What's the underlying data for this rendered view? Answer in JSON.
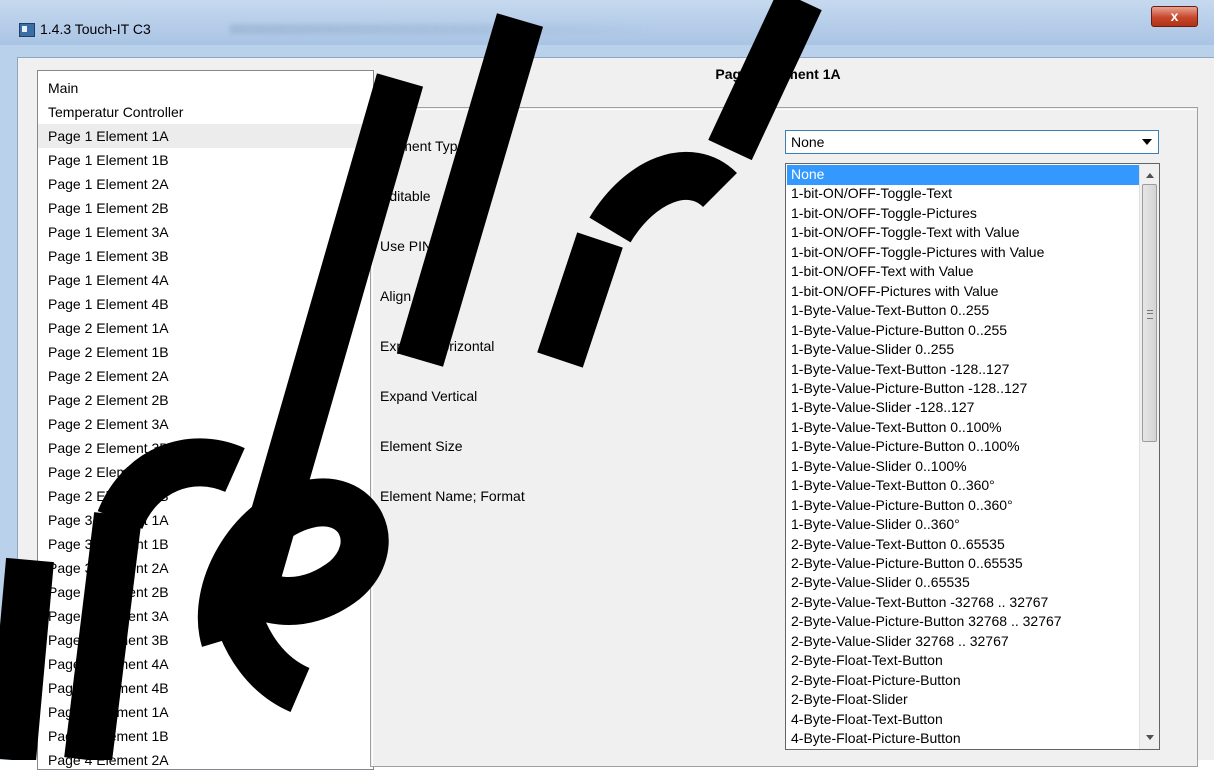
{
  "window": {
    "title": "1.4.3 Touch-IT C3",
    "close_label": "x"
  },
  "tree": {
    "items": [
      "Main",
      "Temperatur Controller",
      "Page 1 Element 1A",
      "Page 1 Element 1B",
      "Page 1 Element 2A",
      "Page 1 Element 2B",
      "Page 1 Element 3A",
      "Page 1 Element 3B",
      "Page 1 Element 4A",
      "Page 1 Element 4B",
      "Page 2 Element 1A",
      "Page 2 Element 1B",
      "Page 2 Element 2A",
      "Page 2 Element 2B",
      "Page 2 Element 3A",
      "Page 2 Element 3B",
      "Page 2 Element 4A",
      "Page 2 Element 4B",
      "Page 3 Element 1A",
      "Page 3 Element 1B",
      "Page 3 Element 2A",
      "Page 3 Element 2B",
      "Page 3 Element 3A",
      "Page 3 Element 3B",
      "Page 3 Element 4A",
      "Page 3 Element 4B",
      "Page 4 Element 1A",
      "Page 4 Element 1B",
      "Page 4 Element 2A"
    ],
    "selected": "Page 1 Element 1A"
  },
  "page": {
    "title": "Page 1 Element 1A"
  },
  "params": {
    "labels": [
      "Element Type",
      "Editable",
      "Use PIN",
      "Align Steps",
      "Expand Horizontal",
      "Expand Vertical",
      "Element Size",
      "Element Name; Format"
    ]
  },
  "element_type": {
    "value": "None",
    "options": [
      "None",
      "1-bit-ON/OFF-Toggle-Text",
      "1-bit-ON/OFF-Toggle-Pictures",
      "1-bit-ON/OFF-Toggle-Text with Value",
      "1-bit-ON/OFF-Toggle-Pictures with Value",
      "1-bit-ON/OFF-Text with Value",
      "1-bit-ON/OFF-Pictures with Value",
      "1-Byte-Value-Text-Button 0..255",
      "1-Byte-Value-Picture-Button 0..255",
      "1-Byte-Value-Slider 0..255",
      "1-Byte-Value-Text-Button -128..127",
      "1-Byte-Value-Picture-Button -128..127",
      "1-Byte-Value-Slider -128..127",
      "1-Byte-Value-Text-Button 0..100%",
      "1-Byte-Value-Picture-Button 0..100%",
      "1-Byte-Value-Slider 0..100%",
      "1-Byte-Value-Text-Button 0..360°",
      "1-Byte-Value-Picture-Button 0..360°",
      "1-Byte-Value-Slider 0..360°",
      "2-Byte-Value-Text-Button 0..65535",
      "2-Byte-Value-Picture-Button 0..65535",
      "2-Byte-Value-Slider 0..65535",
      "2-Byte-Value-Text-Button -32768 .. 32767",
      "2-Byte-Value-Picture-Button 32768 .. 32767",
      "2-Byte-Value-Slider 32768 .. 32767",
      "2-Byte-Float-Text-Button",
      "2-Byte-Float-Picture-Button",
      "2-Byte-Float-Slider",
      "4-Byte-Float-Text-Button",
      "4-Byte-Float-Picture-Button"
    ],
    "highlighted": "None"
  },
  "colors": {
    "selection": "#3399ff",
    "close_button": "#c7472c",
    "titlebar": "#b9d1ea"
  }
}
